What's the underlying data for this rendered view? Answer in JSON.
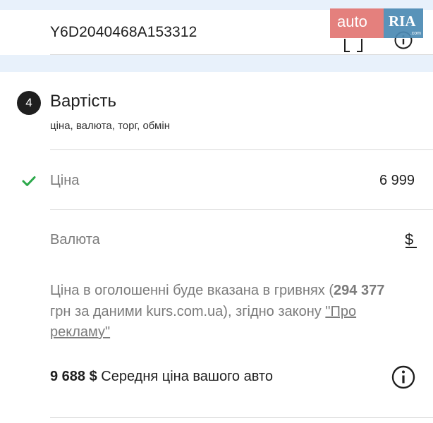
{
  "vin": {
    "value": "Y6D2040468A153312"
  },
  "watermark": {
    "auto": "auto",
    "ria": "RIA",
    "suffix": ".com"
  },
  "section": {
    "step": "4",
    "title": "Вартість",
    "subtitle": "ціна, валюта, торг, обмін"
  },
  "price": {
    "label": "Ціна",
    "value": "6 999",
    "status": "filled"
  },
  "currency": {
    "label": "Валюта",
    "value": "$"
  },
  "note": {
    "part1": "Ціна в оголошенні буде вказана в гривнях (",
    "uah_amount": "294 377",
    "part2": " грн за даними kurs.com.ua), згідно закону ",
    "law_link": "\"Про рекламу\""
  },
  "average": {
    "amount": "9 688 $",
    "text": " Середня ціна вашого авто"
  },
  "colors": {
    "check": "#2ba84a",
    "badge": "#1f1f1f",
    "section_bg": "#e8f1fb"
  },
  "icons": [
    "scan-icon",
    "info-icon",
    "check-icon"
  ]
}
